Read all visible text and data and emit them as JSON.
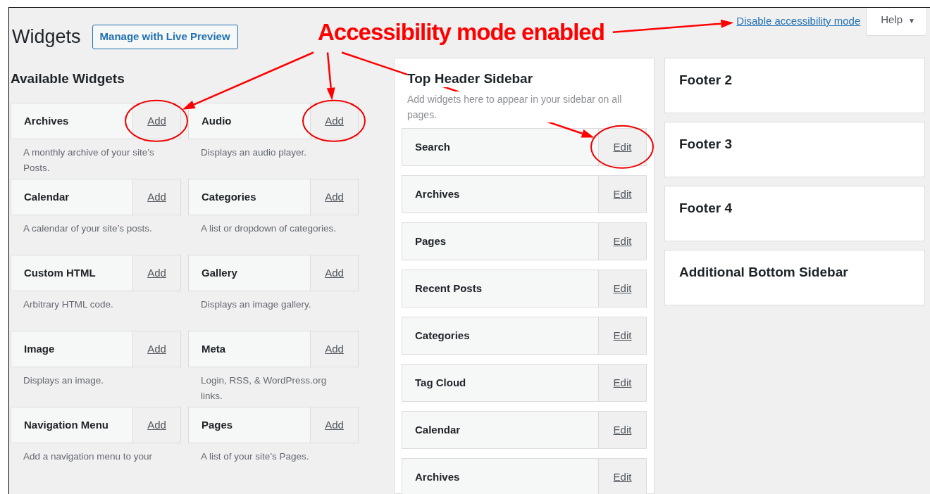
{
  "page": {
    "title": "Widgets",
    "live_preview_button": "Manage with Live Preview"
  },
  "top_bar": {
    "accessibility_link": {
      "label": "Disable accessibility mode"
    },
    "help": {
      "label": "Help",
      "caret": "▼"
    }
  },
  "available_widgets": {
    "heading": "Available Widgets",
    "widgets": [
      {
        "name": "Archives",
        "action": "Add",
        "description": "A monthly archive of your site’s Posts.",
        "circled": true
      },
      {
        "name": "Audio",
        "action": "Add",
        "description": "Displays an audio player.",
        "circled": true
      },
      {
        "name": "Calendar",
        "action": "Add",
        "description": "A calendar of your site’s posts.",
        "circled": false
      },
      {
        "name": "Categories",
        "action": "Add",
        "description": "A list or dropdown of categories.",
        "circled": false
      },
      {
        "name": "Custom HTML",
        "action": "Add",
        "description": "Arbitrary HTML code.",
        "circled": false
      },
      {
        "name": "Gallery",
        "action": "Add",
        "description": "Displays an image gallery.",
        "circled": false
      },
      {
        "name": "Image",
        "action": "Add",
        "description": "Displays an image.",
        "circled": false
      },
      {
        "name": "Meta",
        "action": "Add",
        "description": "Login, RSS, & WordPress.org links.",
        "circled": false
      },
      {
        "name": "Navigation Menu",
        "action": "Add",
        "description": "Add a navigation menu to your",
        "circled": false
      },
      {
        "name": "Pages",
        "action": "Add",
        "description": "A list of your site’s Pages.",
        "circled": false
      }
    ]
  },
  "sidebar_columns": [
    [
      {
        "title": "Top Header Sidebar",
        "expanded": true,
        "description": "Add widgets here to appear in your sidebar on all pages.",
        "widgets": [
          {
            "name": "Search",
            "action": "Edit",
            "circled": true
          },
          {
            "name": "Archives",
            "action": "Edit",
            "circled": false
          },
          {
            "name": "Pages",
            "action": "Edit",
            "circled": false
          },
          {
            "name": "Recent Posts",
            "action": "Edit",
            "circled": false
          },
          {
            "name": "Categories",
            "action": "Edit",
            "circled": false
          },
          {
            "name": "Tag Cloud",
            "action": "Edit",
            "circled": false
          },
          {
            "name": "Calendar",
            "action": "Edit",
            "circled": false
          },
          {
            "name": "Archives",
            "action": "Edit",
            "circled": false
          }
        ]
      }
    ],
    [
      {
        "title": "Footer 2",
        "expanded": false
      },
      {
        "title": "Footer 3",
        "expanded": false
      },
      {
        "title": "Footer 4",
        "expanded": false
      },
      {
        "title": "Additional Bottom Sidebar",
        "expanded": false
      }
    ]
  ],
  "annotation": {
    "text": "Accessibility mode enabled"
  }
}
